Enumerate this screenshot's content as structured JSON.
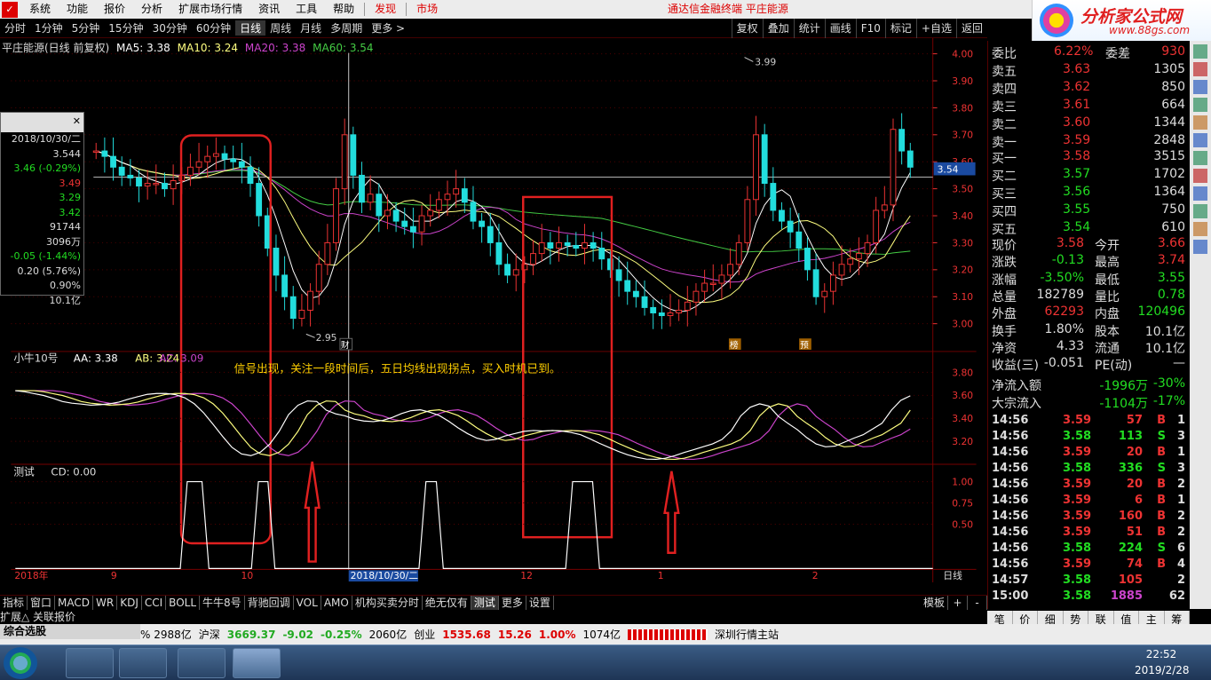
{
  "menu": {
    "items": [
      "系统",
      "功能",
      "报价",
      "分析",
      "扩展市场行情",
      "资讯",
      "工具",
      "帮助"
    ],
    "discover": "发现",
    "market": "市场",
    "promo": "通达信金融终端  平庄能源"
  },
  "logo": {
    "title": "分析家公式网",
    "url": "www.88gs.com"
  },
  "toolbar": {
    "periods": [
      "分时",
      "1分钟",
      "5分钟",
      "15分钟",
      "30分钟",
      "60分钟",
      "日线",
      "周线",
      "月线",
      "多周期",
      "更多 >"
    ],
    "right": [
      "复权",
      "叠加",
      "统计",
      "画线",
      "F10",
      "标记",
      "+自选",
      "返回"
    ]
  },
  "chart": {
    "stock_title": "平庄能源(日线 前复权)",
    "ma5": "MA5: 3.38",
    "ma10": "MA10: 3.24",
    "ma20": "MA20: 3.38",
    "ma60": "MA60: 3.54",
    "y_ticks": [
      "4.00",
      "3.90",
      "3.80",
      "3.70",
      "3.60",
      "3.50",
      "3.40",
      "3.30",
      "3.20",
      "3.10",
      "3.00"
    ],
    "high_mark": "3.99",
    "low_mark": "2.95",
    "price_tag": "3.54",
    "badge_cai": "财",
    "badge_bang": "榜",
    "badge_yu": "预"
  },
  "infobox": {
    "rows": [
      "2018/10/30/二",
      "3.544",
      "3.46 (-0.29%)",
      "3.49",
      "3.29",
      "3.42",
      "91744",
      "3096万",
      "-0.05 (-1.44%)",
      "0.20 (5.76%)",
      "0.90%",
      "10.1亿"
    ]
  },
  "indicator1": {
    "name": "小牛10号",
    "aa": "AA: 3.38",
    "ab": "AB: 3.24",
    "ac": "AC: 3.09",
    "y_ticks": [
      "3.80",
      "3.60",
      "3.40",
      "3.20"
    ],
    "annotation": "信号出现，关注一段时间后，五日均线出现拐点，买入时机已到。"
  },
  "indicator2": {
    "name": "测试",
    "cd": "CD: 0.00",
    "y_ticks": [
      "1.00",
      "0.75",
      "0.50"
    ]
  },
  "xaxis": {
    "labels": [
      "2018年",
      "9",
      "10",
      "2018/10/30/二",
      "12",
      "1",
      "2"
    ],
    "period": "日线"
  },
  "bottom_tabs": [
    "指标",
    "窗口",
    "MACD",
    "WR",
    "KDJ",
    "CCI",
    "BOLL",
    "牛牛8号",
    "背驰回调",
    "VOL",
    "AMO",
    "机构买卖分时",
    "绝无仅有",
    "测试",
    "更多",
    "设置"
  ],
  "bottom_right": [
    "模板",
    "+",
    "-"
  ],
  "expand": "扩展△ 关联报价",
  "order_book": {
    "weibi_label": "委比",
    "weibi": "6.22%",
    "weicha_label": "委差",
    "weicha": "930",
    "asks": [
      {
        "label": "卖五",
        "price": "3.63",
        "vol": "1305"
      },
      {
        "label": "卖四",
        "price": "3.62",
        "vol": "850"
      },
      {
        "label": "卖三",
        "price": "3.61",
        "vol": "664"
      },
      {
        "label": "卖二",
        "price": "3.60",
        "vol": "1344"
      },
      {
        "label": "卖一",
        "price": "3.59",
        "vol": "2848"
      }
    ],
    "bids": [
      {
        "label": "买一",
        "price": "3.58",
        "vol": "3515"
      },
      {
        "label": "买二",
        "price": "3.57",
        "vol": "1702"
      },
      {
        "label": "买三",
        "price": "3.56",
        "vol": "1364"
      },
      {
        "label": "买四",
        "price": "3.55",
        "vol": "750"
      },
      {
        "label": "买五",
        "price": "3.54",
        "vol": "610"
      }
    ]
  },
  "quote": [
    {
      "l1": "现价",
      "v1": "3.58",
      "l2": "今开",
      "v2": "3.66",
      "c1": "#e33",
      "c2": "#e33"
    },
    {
      "l1": "涨跌",
      "v1": "-0.13",
      "l2": "最高",
      "v2": "3.74",
      "c1": "#2d2",
      "c2": "#e33"
    },
    {
      "l1": "涨幅",
      "v1": "-3.50%",
      "l2": "最低",
      "v2": "3.55",
      "c1": "#2d2",
      "c2": "#2d2"
    },
    {
      "l1": "总量",
      "v1": "182789",
      "l2": "量比",
      "v2": "0.78",
      "c1": "#ddd",
      "c2": "#2d2"
    },
    {
      "l1": "外盘",
      "v1": "62293",
      "l2": "内盘",
      "v2": "120496",
      "c1": "#e33",
      "c2": "#2d2"
    },
    {
      "l1": "换手",
      "v1": "1.80%",
      "l2": "股本",
      "v2": "10.1亿",
      "c1": "#ddd",
      "c2": "#ddd"
    },
    {
      "l1": "净资",
      "v1": "4.33",
      "l2": "流通",
      "v2": "10.1亿",
      "c1": "#ddd",
      "c2": "#ddd"
    },
    {
      "l1": "收益(三)",
      "v1": "-0.051",
      "l2": "PE(动)",
      "v2": "—",
      "c1": "#ddd",
      "c2": "#ddd"
    }
  ],
  "flow": [
    {
      "label": "净流入额",
      "value": "-1996万",
      "pct": "-30%"
    },
    {
      "label": "大宗流入",
      "value": "-1104万",
      "pct": "-17%"
    }
  ],
  "ticks": [
    {
      "t": "14:56",
      "p": "3.59",
      "v": "57",
      "s": "B",
      "n": "1"
    },
    {
      "t": "14:56",
      "p": "3.58",
      "v": "113",
      "s": "S",
      "n": "3"
    },
    {
      "t": "14:56",
      "p": "3.59",
      "v": "20",
      "s": "B",
      "n": "1"
    },
    {
      "t": "14:56",
      "p": "3.58",
      "v": "336",
      "s": "S",
      "n": "3"
    },
    {
      "t": "14:56",
      "p": "3.59",
      "v": "20",
      "s": "B",
      "n": "2"
    },
    {
      "t": "14:56",
      "p": "3.59",
      "v": "6",
      "s": "B",
      "n": "1"
    },
    {
      "t": "14:56",
      "p": "3.59",
      "v": "160",
      "s": "B",
      "n": "2"
    },
    {
      "t": "14:56",
      "p": "3.59",
      "v": "51",
      "s": "B",
      "n": "2"
    },
    {
      "t": "14:56",
      "p": "3.58",
      "v": "224",
      "s": "S",
      "n": "6"
    },
    {
      "t": "14:56",
      "p": "3.59",
      "v": "74",
      "s": "B",
      "n": "4"
    },
    {
      "t": "14:57",
      "p": "3.58",
      "v": "105",
      "s": "",
      "n": "2"
    },
    {
      "t": "15:00",
      "p": "3.58",
      "v": "1885",
      "s": "",
      "n": "62"
    }
  ],
  "rp_tabs": [
    "笔",
    "价",
    "细",
    "势",
    "联",
    "值",
    "主",
    "筹"
  ],
  "status": {
    "v1": "% 2988亿",
    "shen_label": "沪深",
    "shen": "3669.37",
    "shen_chg": "-9.02",
    "shen_pct": "-0.25%",
    "shen_amt": "2060亿",
    "cy_label": "创业",
    "cy": "1535.68",
    "cy_chg": "15.26",
    "cy_pct": "1.00%",
    "cy_amt": "1074亿",
    "station": "深圳行情主站"
  },
  "select_panel": "综合选股",
  "clock": {
    "time": "22:52",
    "date": "2019/2/28"
  },
  "colors": {
    "up": "#e33",
    "down": "#2dd",
    "ma5": "#ffffff",
    "ma10": "#ffff80",
    "ma20": "#cc44cc",
    "ma60": "#44cc44",
    "highlight": "#e02020"
  }
}
